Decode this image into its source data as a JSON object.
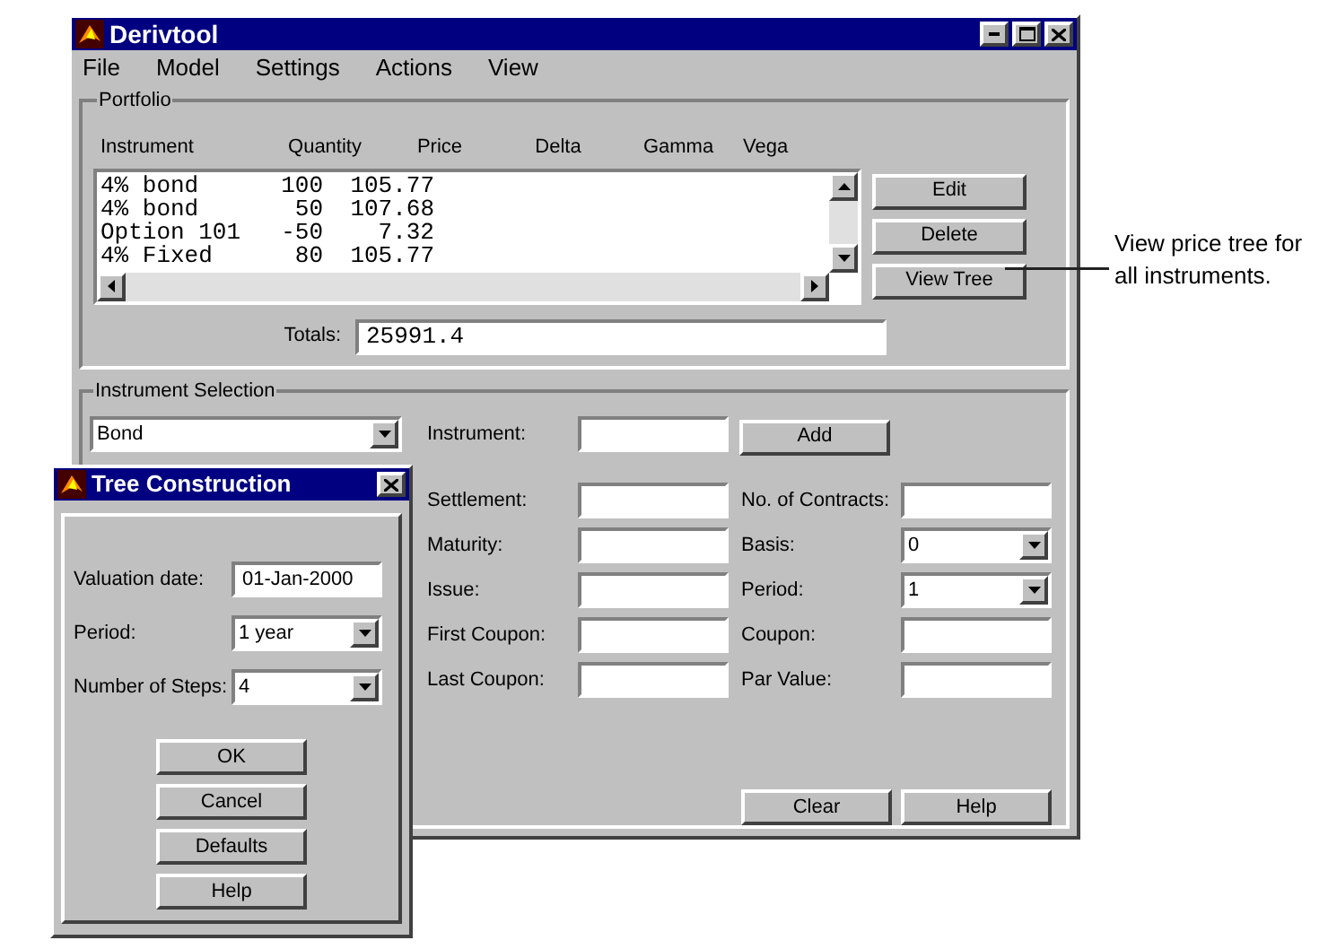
{
  "window": {
    "title": "Derivtool",
    "menu": [
      "File",
      "Model",
      "Settings",
      "Actions",
      "View"
    ]
  },
  "portfolio": {
    "title": "Portfolio",
    "columns": [
      "Instrument",
      "Quantity",
      "Price",
      "Delta",
      "Gamma",
      "Vega"
    ],
    "rows": [
      {
        "instrument": "4% bond",
        "quantity": "100",
        "price": "105.77"
      },
      {
        "instrument": "4% bond",
        "quantity": "50",
        "price": "107.68"
      },
      {
        "instrument": "Option 101",
        "quantity": "-50",
        "price": "7.32"
      },
      {
        "instrument": "4% Fixed",
        "quantity": "80",
        "price": "105.77"
      }
    ],
    "buttons": [
      "Edit",
      "Delete",
      "View Tree"
    ],
    "totals_label": "Totals:",
    "totals_value": "25991.4"
  },
  "instrument_selection": {
    "title": "Instrument Selection",
    "type": "Bond",
    "instrument_label": "Instrument:",
    "add_button": "Add",
    "left_fields": [
      {
        "label": "Settlement:",
        "kind": "text"
      },
      {
        "label": "Maturity:",
        "kind": "text"
      },
      {
        "label": "Issue:",
        "kind": "text"
      },
      {
        "label": "First Coupon:",
        "kind": "text"
      },
      {
        "label": "Last Coupon:",
        "kind": "text"
      }
    ],
    "right_fields": [
      {
        "label": "No. of Contracts:",
        "kind": "text"
      },
      {
        "label": "Basis:",
        "kind": "dropdown",
        "value": "0"
      },
      {
        "label": "Period:",
        "kind": "dropdown",
        "value": "1"
      },
      {
        "label": "Coupon:",
        "kind": "text"
      },
      {
        "label": "Par Value:",
        "kind": "text"
      }
    ],
    "buttons": [
      "Clear",
      "Help"
    ]
  },
  "dialog": {
    "title": "Tree Construction",
    "fields": [
      {
        "label": "Valuation date:",
        "kind": "text",
        "value": "01-Jan-2000"
      },
      {
        "label": "Period:",
        "kind": "dropdown",
        "value": "1 year"
      },
      {
        "label": "Number of Steps:",
        "kind": "dropdown",
        "value": "4"
      }
    ],
    "buttons": [
      "OK",
      "Cancel",
      "Defaults",
      "Help"
    ]
  },
  "callout": {
    "text": "View price tree for all instruments."
  }
}
